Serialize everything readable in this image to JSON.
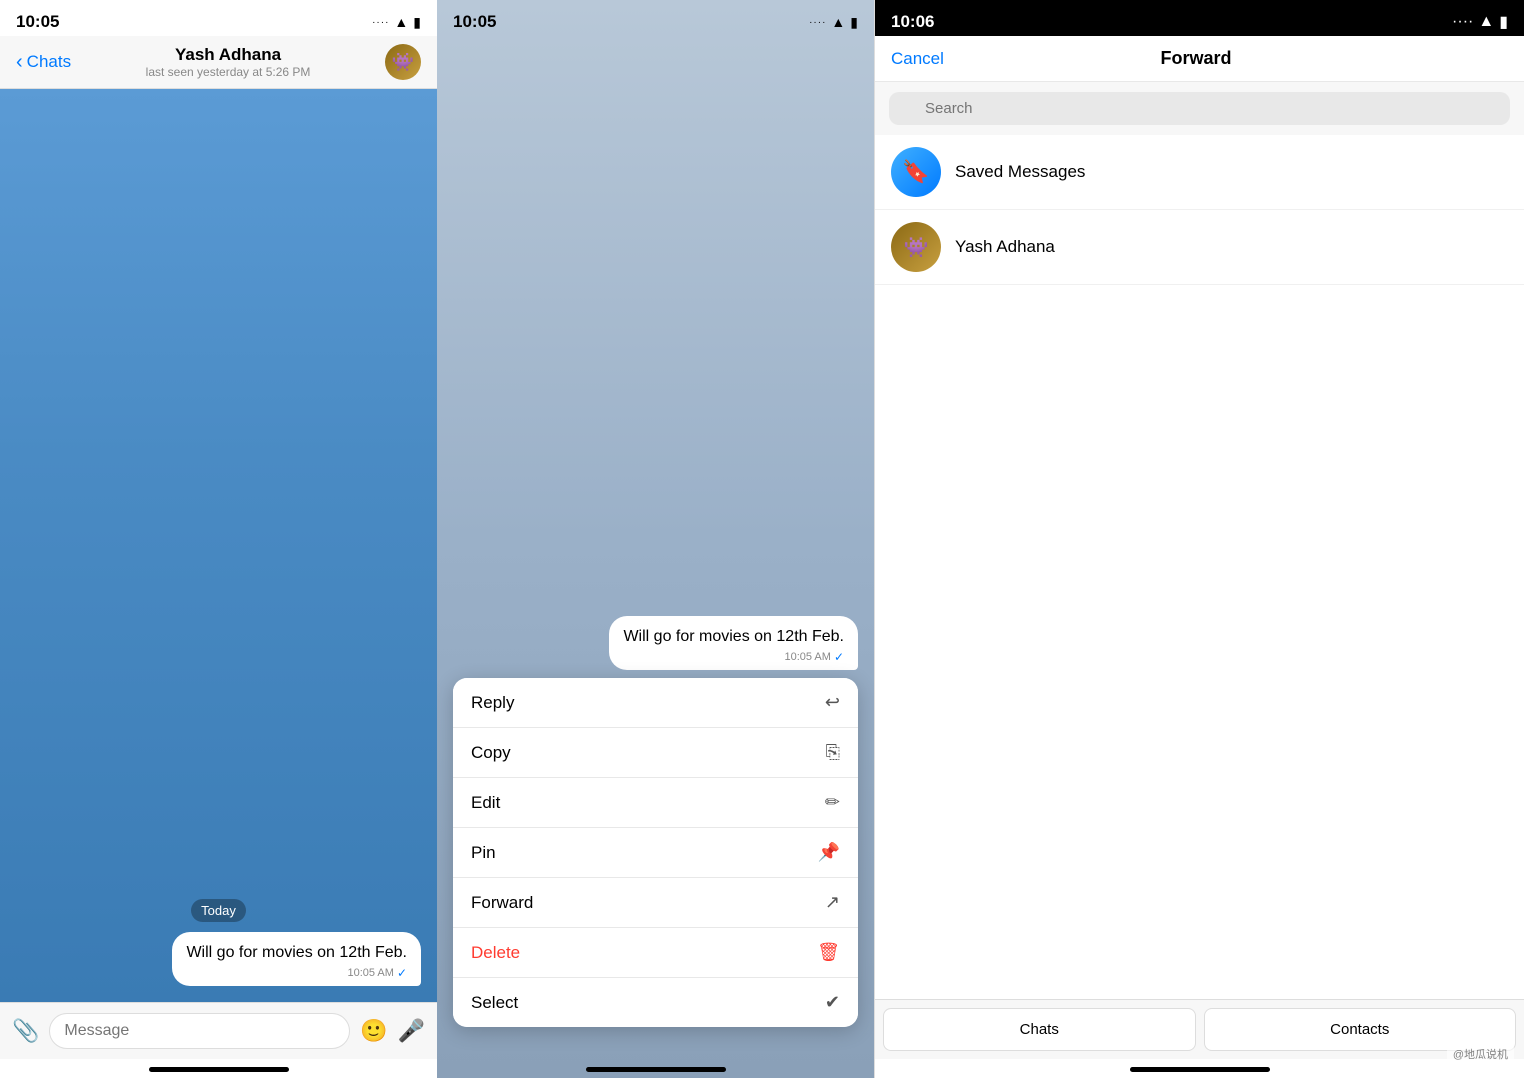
{
  "panel1": {
    "status_time": "10:05",
    "nav_back_label": "Chats",
    "contact_name": "Yash Adhana",
    "contact_status": "last seen yesterday at 5:26 PM",
    "chat_bg_gradient_top": "#5b9bd5",
    "chat_bg_gradient_bottom": "#3a7bb4",
    "date_badge": "Today",
    "message_text": "Will go for movies on 12th Feb.",
    "message_time": "10:05 AM",
    "message_check": "✓",
    "input_placeholder": "Message",
    "attach_icon": "📎",
    "sticker_icon": "🙂",
    "mic_icon": "🎤"
  },
  "panel2": {
    "status_time": "10:05",
    "message_text": "Will go for movies on 12th Feb.",
    "message_time": "10:05 AM",
    "menu_items": [
      {
        "label": "Reply",
        "icon": "↩",
        "type": "normal"
      },
      {
        "label": "Copy",
        "icon": "⎘",
        "type": "normal"
      },
      {
        "label": "Edit",
        "icon": "✏",
        "type": "normal"
      },
      {
        "label": "Pin",
        "icon": "📌",
        "type": "normal"
      },
      {
        "label": "Forward",
        "icon": "↗",
        "type": "normal"
      },
      {
        "label": "Delete",
        "icon": "🗑",
        "type": "delete"
      },
      {
        "label": "Select",
        "icon": "✔",
        "type": "normal"
      }
    ]
  },
  "panel3": {
    "status_time": "10:06",
    "cancel_label": "Cancel",
    "title": "Forward",
    "search_placeholder": "Search",
    "contacts": [
      {
        "name": "Saved Messages",
        "avatar_type": "saved",
        "avatar_icon": "🔖"
      },
      {
        "name": "Yash Adhana",
        "avatar_type": "contact",
        "avatar_icon": "👾"
      }
    ],
    "tab_chats": "Chats",
    "tab_contacts": "Contacts",
    "watermark": "@地瓜说机"
  }
}
